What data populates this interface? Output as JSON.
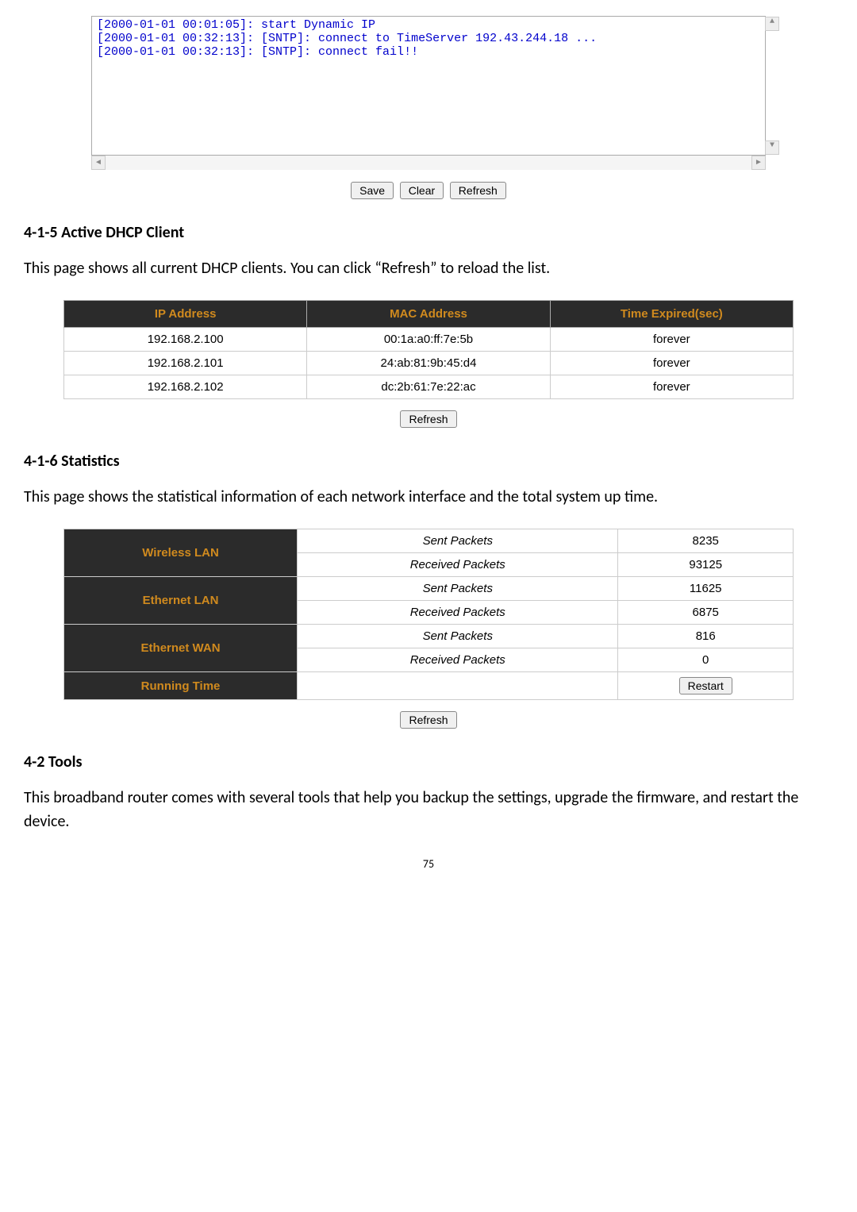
{
  "log": {
    "lines": [
      "[2000-01-01 00:01:05]: start Dynamic IP",
      "[2000-01-01 00:32:13]: [SNTP]: connect to TimeServer 192.43.244.18 ...",
      "[2000-01-01 00:32:13]: [SNTP]: connect fail!!"
    ],
    "save": "Save",
    "clear": "Clear",
    "refresh": "Refresh"
  },
  "section_dhcp": {
    "heading": "4-1-5 Active DHCP Client",
    "intro": "This page shows all current DHCP clients. You can click “Refresh” to reload the list.",
    "headers": {
      "ip": "IP Address",
      "mac": "MAC Address",
      "time": "Time Expired(sec)"
    },
    "rows": [
      {
        "ip": "192.168.2.100",
        "mac": "00:1a:a0:ff:7e:5b",
        "time": "forever"
      },
      {
        "ip": "192.168.2.101",
        "mac": "24:ab:81:9b:45:d4",
        "time": "forever"
      },
      {
        "ip": "192.168.2.102",
        "mac": "dc:2b:61:7e:22:ac",
        "time": "forever"
      }
    ],
    "refresh": "Refresh"
  },
  "section_stats": {
    "heading": "4-1-6 Statistics",
    "intro": "This page shows the statistical information of each network interface and the total system up time.",
    "labels": {
      "wlan": "Wireless LAN",
      "elan": "Ethernet LAN",
      "ewan": "Ethernet WAN",
      "rtime": "Running Time",
      "sent": "Sent Packets",
      "recv": "Received Packets"
    },
    "values": {
      "wlan_sent": "8235",
      "wlan_recv": "93125",
      "elan_sent": "11625",
      "elan_recv": "6875",
      "ewan_sent": "816",
      "ewan_recv": "0"
    },
    "restart": "Restart",
    "refresh": "Refresh"
  },
  "section_tools": {
    "heading": "4-2 Tools",
    "intro": "This broadband router comes with several tools that help you backup the settings, upgrade the firmware, and restart the device."
  },
  "page_number": "75"
}
